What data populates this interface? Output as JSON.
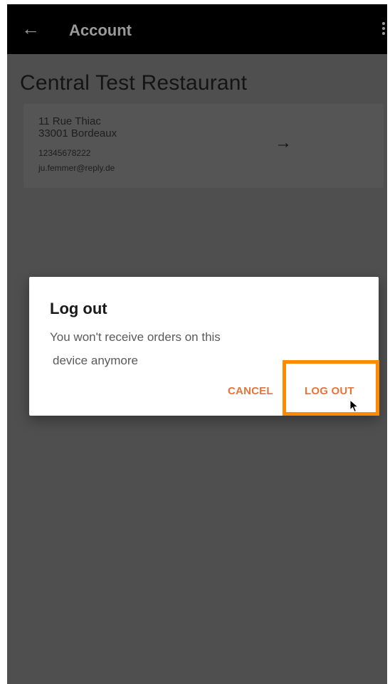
{
  "app_bar": {
    "title": "Account",
    "back_icon": "arrow-left-icon",
    "menu_icon": "more-vert-icon"
  },
  "restaurant": {
    "name": "Central Test Restaurant",
    "street": "11 Rue Thiac",
    "city": "33001 Bordeaux",
    "phone": "12345678222",
    "email": "ju.femmer@reply.de",
    "arrow_icon": "arrow-right-icon"
  },
  "dialog": {
    "title": "Log out",
    "message_line1": "You won't receive orders on this",
    "message_line2": "device anymore",
    "cancel_label": "CANCEL",
    "logout_label": "LOG OUT"
  },
  "colors": {
    "accent": "#e8743c",
    "highlight": "#ff8a00",
    "app_bar": "#000000",
    "overlay_bg": "#4f4f4f"
  }
}
